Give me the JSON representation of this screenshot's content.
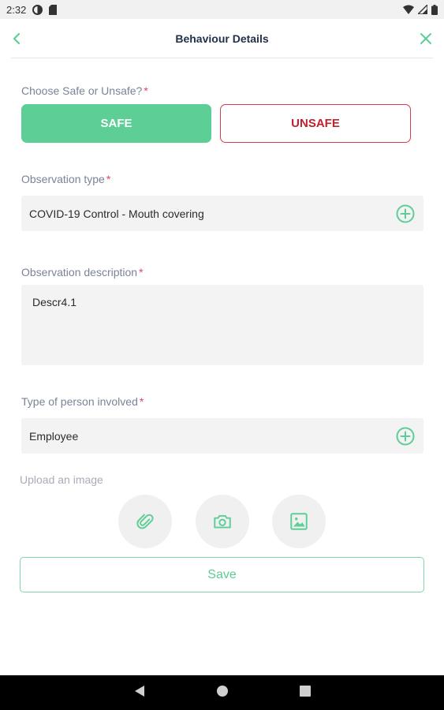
{
  "status_bar": {
    "time": "2:32"
  },
  "header": {
    "title": "Behaviour Details"
  },
  "safety": {
    "label": "Choose Safe or Unsafe?",
    "required_mark": "*",
    "safe_label": "SAFE",
    "unsafe_label": "UNSAFE",
    "selected": "SAFE"
  },
  "observation_type": {
    "label": "Observation type",
    "required_mark": "*",
    "value": "COVID-19 Control - Mouth covering"
  },
  "observation_description": {
    "label": "Observation description",
    "required_mark": "*",
    "value": "Descr4.1"
  },
  "person_type": {
    "label": "Type of person involved",
    "required_mark": "*",
    "value": "Employee"
  },
  "upload": {
    "label": "Upload an image",
    "buttons": [
      "paperclip-icon",
      "camera-icon",
      "image-icon"
    ]
  },
  "save_label": "Save",
  "colors": {
    "accent": "#5cce96",
    "danger": "#c3202e",
    "required": "#e0456a",
    "title": "#22304a"
  }
}
